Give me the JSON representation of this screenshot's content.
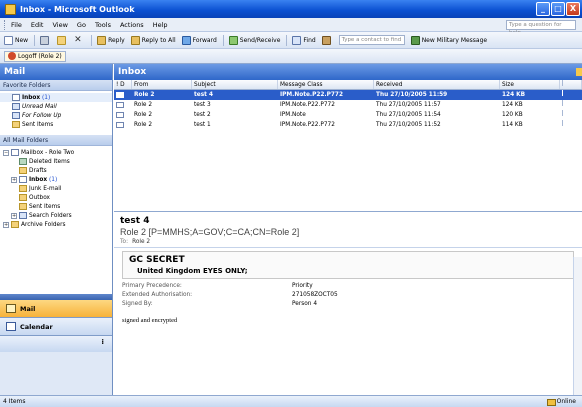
{
  "window": {
    "title": "Inbox - Microsoft Outlook",
    "minimize": "_",
    "maximize": "□",
    "close": "X"
  },
  "menu": {
    "items": [
      "File",
      "Edit",
      "View",
      "Go",
      "Tools",
      "Actions",
      "Help"
    ],
    "help_placeholder": "Type a question for help"
  },
  "toolbar": {
    "new": "New",
    "reply": "Reply",
    "reply_all": "Reply to All",
    "forward": "Forward",
    "send_receive": "Send/Receive",
    "find": "Find",
    "contact_placeholder": "Type a contact to find",
    "new_military_message": "New Military Message"
  },
  "toolbar2": {
    "logoff": "Logoff (Role 2)"
  },
  "nav": {
    "title": "Mail",
    "favorites_title": "Favorite Folders",
    "favorites": [
      {
        "label": "Inbox",
        "count": "(1)"
      },
      {
        "label": "Unread Mail"
      },
      {
        "label": "For Follow Up"
      },
      {
        "label": "Sent Items"
      }
    ],
    "all_folders_title": "All Mail Folders",
    "tree": {
      "mailbox": "Mailbox - Role Two",
      "deleted": "Deleted Items",
      "drafts": "Drafts",
      "inbox": "Inbox",
      "inbox_count": "(1)",
      "junk": "Junk E-mail",
      "outbox": "Outbox",
      "sent": "Sent Items",
      "search": "Search Folders",
      "archive": "Archive Folders"
    },
    "buttons": {
      "mail": "Mail",
      "calendar": "Calendar"
    },
    "more": "⁝"
  },
  "inbox": {
    "title": "Inbox",
    "columns": {
      "from": "From",
      "subject": "Subject",
      "message_class": "Message Class",
      "received": "Received",
      "size": "Size"
    },
    "rows": [
      {
        "from": "Role 2",
        "subject": "test 4",
        "message_class": "IPM.Note.P22.P772",
        "received": "Thu 27/10/2005 11:59",
        "size": "124 KB"
      },
      {
        "from": "Role 2",
        "subject": "test 3",
        "message_class": "IPM.Note.P22.P772",
        "received": "Thu 27/10/2005 11:57",
        "size": "124 KB"
      },
      {
        "from": "Role 2",
        "subject": "test 2",
        "message_class": "IPM.Note",
        "received": "Thu 27/10/2005 11:54",
        "size": "120 KB"
      },
      {
        "from": "Role 2",
        "subject": "test 1",
        "message_class": "IPM.Note.P22.P772",
        "received": "Thu 27/10/2005 11:52",
        "size": "114 KB"
      }
    ]
  },
  "reading": {
    "subject": "test 4",
    "from": "Role 2 [P=MMHS;A=GOV;C=CA;CN=Role 2]",
    "to_label": "To:",
    "to": "Role 2",
    "classification": "GC SECRET",
    "caveat": "United Kingdom  EYES ONLY;",
    "properties": [
      {
        "key": "Primary Precedence:",
        "value": "Priority"
      },
      {
        "key": "Extended Authorisation:",
        "value": "271058ZOCT05"
      },
      {
        "key": "Signed By:",
        "value": "Person 4"
      }
    ],
    "body": "signed and encrypted"
  },
  "status": {
    "items": "4 Items",
    "connection": "Online"
  }
}
